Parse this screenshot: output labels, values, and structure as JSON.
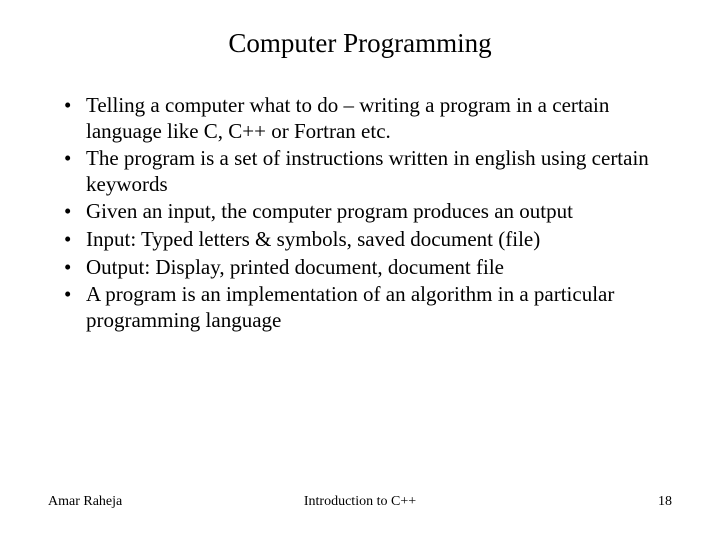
{
  "title": "Computer Programming",
  "bullets": [
    "Telling a computer what to do – writing a program in a certain language like C, C++ or Fortran etc.",
    "The program is a set of instructions written in english using certain keywords",
    "Given an input, the computer program produces an output",
    "Input: Typed letters & symbols, saved document (file)",
    "Output: Display, printed document, document file",
    "A program is an implementation of an algorithm in a particular programming language"
  ],
  "footer": {
    "author": "Amar Raheja",
    "center": "Introduction to C++",
    "page": "18"
  }
}
